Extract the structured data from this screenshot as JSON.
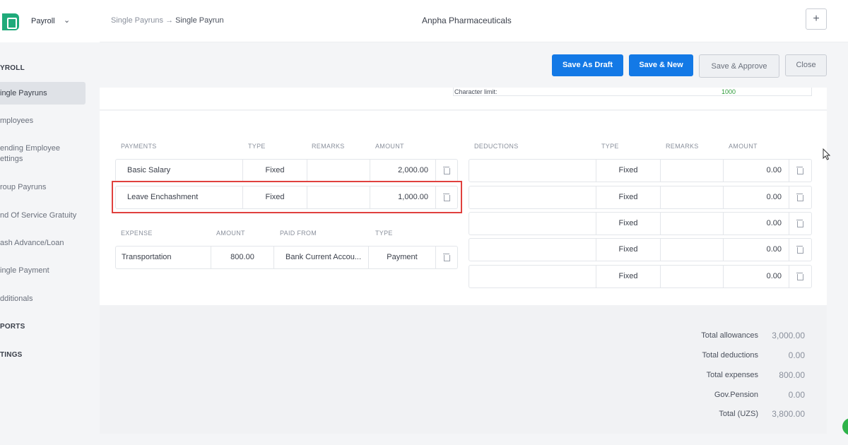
{
  "app": {
    "name": "Payroll"
  },
  "sidebar": {
    "section_payroll": "YROLL",
    "items": [
      {
        "label": "ingle Payruns",
        "active": true
      },
      {
        "label": "mployees"
      },
      {
        "label": "ending Employee ettings"
      },
      {
        "label": "roup Payruns"
      },
      {
        "label": "nd Of Service Gratuity"
      },
      {
        "label": "ash Advance/Loan"
      },
      {
        "label": "ingle Payment"
      },
      {
        "label": "dditionals"
      }
    ],
    "section_reports": "PORTS",
    "section_settings": "TINGS"
  },
  "topbar": {
    "breadcrumb_parent": "Single Payruns",
    "breadcrumb_sep": "→",
    "breadcrumb_current": "Single Payrun",
    "company": "Anpha Pharmaceuticals",
    "plus_label": "+"
  },
  "actions": {
    "save_draft": "Save As Draft",
    "save_new": "Save & New",
    "save_approve": "Save & Approve",
    "close": "Close"
  },
  "character_limit": {
    "label": "Character limit:",
    "value": "1000"
  },
  "payments": {
    "headers": [
      "PAYMENTS",
      "TYPE",
      "REMARKS",
      "AMOUNT"
    ],
    "rows": [
      {
        "name": "Basic Salary",
        "type": "Fixed",
        "remarks": "",
        "amount": "2,000.00"
      },
      {
        "name": "Leave Enchashment",
        "type": "Fixed",
        "remarks": "",
        "amount": "1,000.00"
      }
    ]
  },
  "expense": {
    "headers": [
      "EXPENSE",
      "AMOUNT",
      "PAID FROM",
      "TYPE"
    ],
    "rows": [
      {
        "name": "Transportation",
        "amount": "800.00",
        "paid_from": "Bank Current Accou...",
        "type": "Payment"
      }
    ]
  },
  "deductions": {
    "headers": [
      "DEDUCTIONS",
      "TYPE",
      "REMARKS",
      "AMOUNT"
    ],
    "rows": [
      {
        "name": "",
        "type": "Fixed",
        "remarks": "",
        "amount": "0.00"
      },
      {
        "name": "",
        "type": "Fixed",
        "remarks": "",
        "amount": "0.00"
      },
      {
        "name": "",
        "type": "Fixed",
        "remarks": "",
        "amount": "0.00"
      },
      {
        "name": "",
        "type": "Fixed",
        "remarks": "",
        "amount": "0.00"
      },
      {
        "name": "",
        "type": "Fixed",
        "remarks": "",
        "amount": "0.00"
      }
    ]
  },
  "totals": [
    {
      "label": "Total allowances",
      "value": "3,000.00"
    },
    {
      "label": "Total deductions",
      "value": "0.00"
    },
    {
      "label": "Total expenses",
      "value": "800.00"
    },
    {
      "label": "Gov.Pension",
      "value": "0.00"
    },
    {
      "label": "Total (UZS)",
      "value": "3,800.00"
    }
  ],
  "colors": {
    "primary": "#1379e6",
    "highlight": "#e0413e",
    "brand": "#1faa7a"
  }
}
